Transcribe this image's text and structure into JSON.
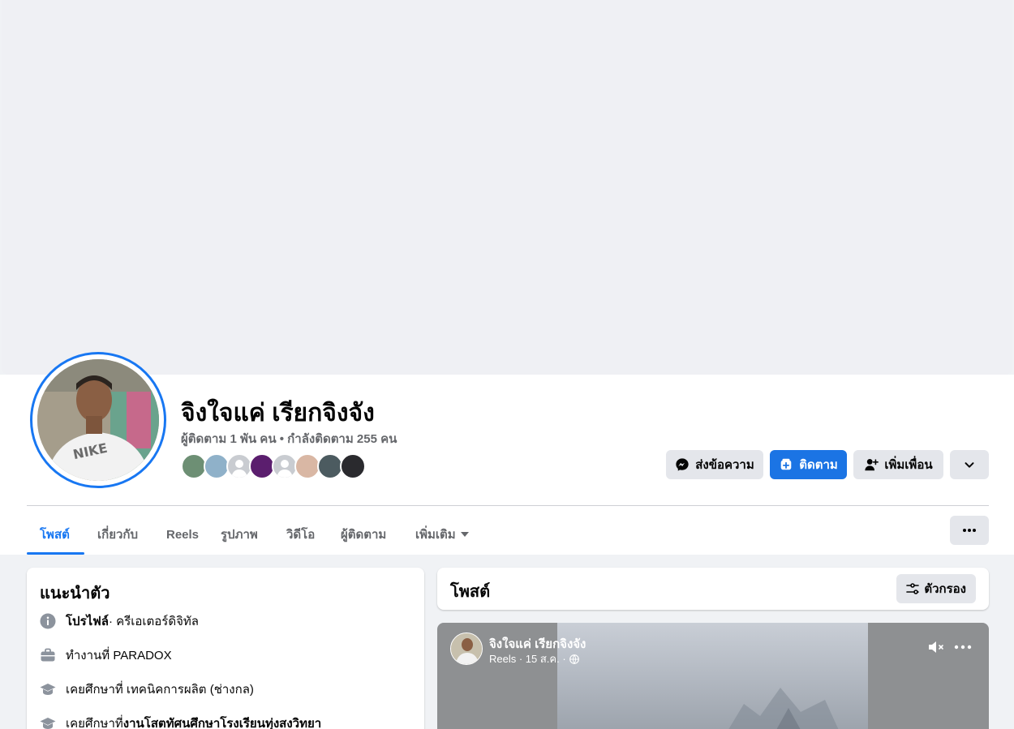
{
  "profile": {
    "name": "จิงใจแค่ เรียกจิงจัง",
    "stats": "ผู้ติดตาม 1 พัน คน • กำลังติดตาม 255 คน",
    "friend_avatar_colors": [
      "#6d8f74",
      "#8fb1c9",
      "#c9ccd1",
      "#5b1e6e",
      "#c9ccd1",
      "#d9b7a4",
      "#4c5b60",
      "#2a2a2e"
    ]
  },
  "actions": {
    "message_label": "ส่งข้อความ",
    "follow_label": "ติดตาม",
    "add_friend_label": "เพิ่มเพื่อน"
  },
  "tabs": [
    {
      "label": "โพสต์"
    },
    {
      "label": "เกี่ยวกับ"
    },
    {
      "label": "Reels"
    },
    {
      "label": "รูปภาพ"
    },
    {
      "label": "วิดีโอ"
    },
    {
      "label": "ผู้ติดตาม"
    },
    {
      "label": "เพิ่มเติม"
    }
  ],
  "intro": {
    "title": "แนะนำตัว",
    "profile_label": "โปรไฟล์",
    "profile_value": " · ครีเอเตอร์ดิจิทัล",
    "work": "ทำงานที่ PARADOX",
    "edu1": "เคยศึกษาที่ เทคนิคการผลิต (ช่างกล)",
    "edu2_prefix": "เคยศึกษาที่ ",
    "edu2_school": "งานโสตทัศนศึกษาโรงเรียนทุ่งสงวิทยา"
  },
  "posts": {
    "title": "โพสต์",
    "filter_label": "ตัวกรอง"
  },
  "reel": {
    "author": "จิงใจแค่ เรียกจิงจัง",
    "meta": "Reels · 15 ส.ค. ·"
  },
  "colors": {
    "accent": "#1877f2",
    "button_blue": "#1b74e4",
    "button_gray": "#e4e6eb",
    "page_bg": "#f0f2f5"
  }
}
